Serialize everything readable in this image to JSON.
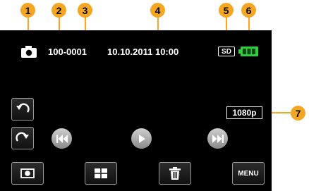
{
  "callouts": [
    "1",
    "2",
    "3",
    "4",
    "5",
    "6",
    "7"
  ],
  "header": {
    "folder_file": "100-0001",
    "datetime": "10.10.2011 10:00",
    "media": "SD"
  },
  "resolution": "1080p",
  "menu_label": "MENU",
  "icons": {
    "mode": "camera-icon",
    "battery": "battery-icon",
    "rotate_left": "rotate-left-icon",
    "rotate_right": "rotate-right-icon",
    "prev": "skip-previous-icon",
    "play": "play-icon",
    "next": "skip-next-icon",
    "slideshow": "slideshow-icon",
    "index": "index-grid-icon",
    "delete": "trash-icon"
  },
  "colors": {
    "callout": "#f5a623",
    "battery": "#2ecc40",
    "screen": "#000000"
  }
}
